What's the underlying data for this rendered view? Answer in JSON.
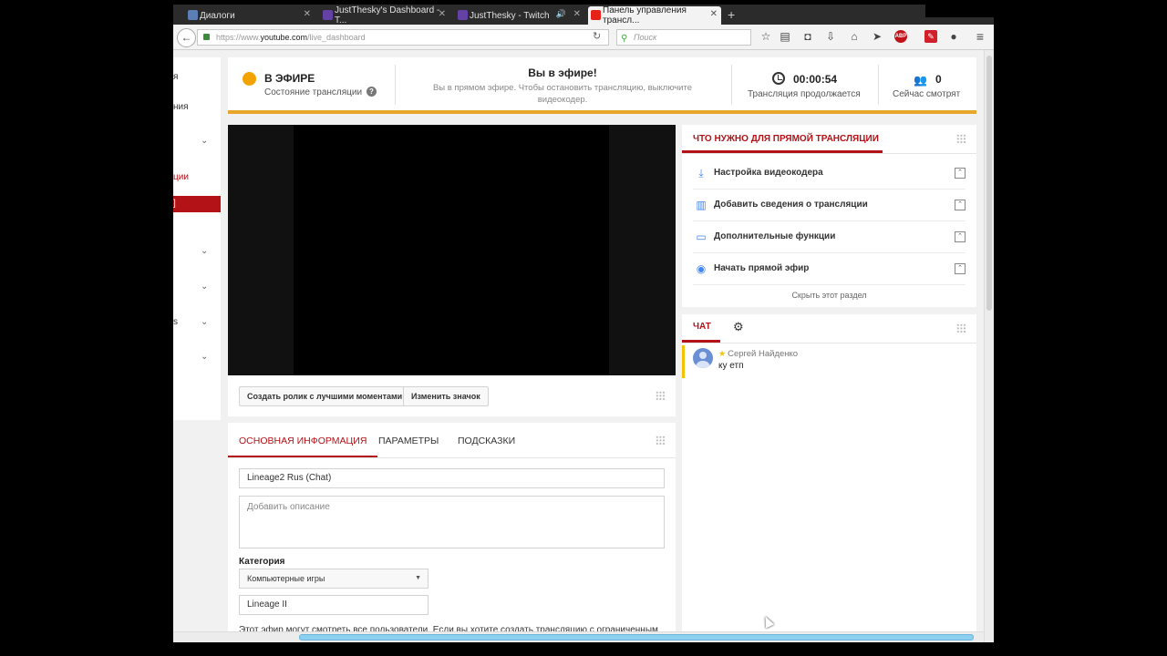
{
  "browser": {
    "tabs": [
      {
        "label": "Диалоги",
        "fav_color": "#5b7fb5"
      },
      {
        "label": "JustThesky's Dashboard - T...",
        "fav_color": "#6441a5"
      },
      {
        "label": "JustThesky - Twitch",
        "fav_color": "#6441a5"
      },
      {
        "label": "Панель управления трансл...",
        "fav_color": "#e62117"
      }
    ],
    "new_tab": "+",
    "url_prefix": "https://www.",
    "url_host": "youtube.com",
    "url_path": "/live_dashboard",
    "search_placeholder": "Поиск",
    "toolbar_icons": [
      "star-icon",
      "reader-icon",
      "pocket-icon",
      "download-icon",
      "home-icon",
      "send-icon",
      "adblock-icon",
      "extension-icon",
      "chat-icon",
      "menu-icon"
    ]
  },
  "sidebar": {
    "items": [
      "я",
      "ния",
      "ции",
      "]",
      "s"
    ]
  },
  "status": {
    "live_label": "В ЭФИРЕ",
    "live_sub": "Состояние трансляции",
    "title": "Вы в эфире!",
    "subtitle": "Вы в прямом эфире. Чтобы остановить трансляцию, выключите видеокодер.",
    "timer": "00:00:54",
    "timer_sub": "Трансляция продолжается",
    "viewers": "0",
    "viewers_sub": "Сейчас смотрят",
    "live_color": "#f2a300",
    "accent_color": "#e8a62b"
  },
  "player": {
    "highlights_button": "Создать ролик с лучшими моментами",
    "thumbnail_button": "Изменить значок"
  },
  "info": {
    "tabs": [
      "ОСНОВНАЯ ИНФОРМАЦИЯ",
      "ПАРАМЕТРЫ",
      "ПОДСКАЗКИ"
    ],
    "title_value": "Lineage2 Rus (Chat)",
    "description_placeholder": "Добавить описание",
    "category_label": "Категория",
    "category_value": "Компьютерные игры",
    "game_value": "Lineage II",
    "privacy_text": "Этот эфир могут смотреть все пользователи. Если вы хотите создать трансляцию с ограниченным"
  },
  "checklist": {
    "title": "ЧТО НУЖНО ДЛЯ ПРЯМОЙ ТРАНСЛЯЦИИ",
    "items": [
      {
        "label": "Настройка видеокодера",
        "icon": "download-icon"
      },
      {
        "label": "Добавить сведения о трансляции",
        "icon": "bar-chart-icon"
      },
      {
        "label": "Дополнительные функции",
        "icon": "card-icon"
      },
      {
        "label": "Начать прямой эфир",
        "icon": "broadcast-icon"
      }
    ],
    "hide_label": "Скрыть этот раздел"
  },
  "chat": {
    "tab_label": "ЧАТ",
    "message": {
      "author": "Сергей Найденко",
      "text": "ку етп"
    }
  },
  "brand_color": "#b31217"
}
